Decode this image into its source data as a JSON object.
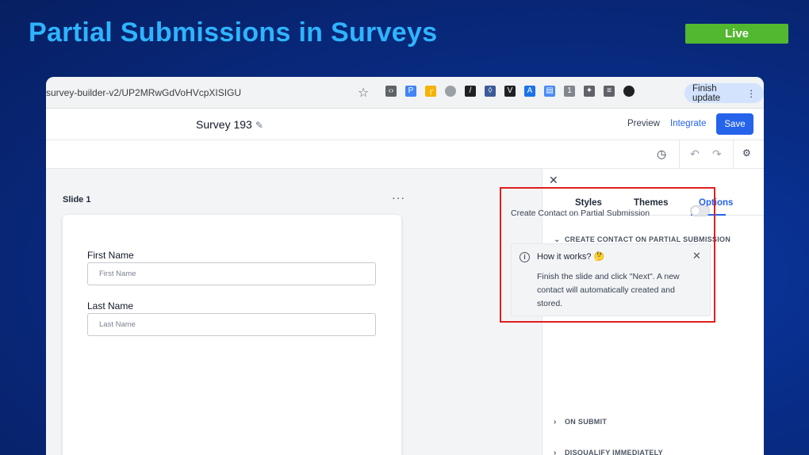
{
  "slide": {
    "title": "Partial Submissions in Surveys",
    "badge": "Live"
  },
  "browser": {
    "url": "survey-builder-v2/UP2MRwGdVoHVcpXISIGU",
    "finish_update_label": "Finish update",
    "finish_update_menu": "⋮",
    "bookmark_icon": "star-icon"
  },
  "header": {
    "survey_name": "Survey 193",
    "preview_label": "Preview",
    "integrate_label": "Integrate",
    "save_label": "Save"
  },
  "form": {
    "slide_label": "Slide 1",
    "slide_menu": "···",
    "fields": [
      {
        "label": "First Name",
        "placeholder": "First Name"
      },
      {
        "label": "Last Name",
        "placeholder": "Last Name"
      }
    ]
  },
  "panel": {
    "tabs": [
      "Styles",
      "Themes",
      "Options"
    ],
    "active_tab": "Options",
    "sections": {
      "create_contact": "CREATE CONTACT ON PARTIAL SUBMISSION",
      "on_submit": "ON SUBMIT",
      "disqualify": "DISQUALIFY IMMEDIATELY"
    },
    "toggle_label": "Create Contact on Partial Submission",
    "toggle_on": false,
    "info": {
      "title": "How it works? 🤔",
      "text": "Finish the slide and click \"Next\". A new contact will automatically created and stored."
    }
  },
  "colors": {
    "accent": "#2563eb",
    "title": "#2fb4ff",
    "live": "#52b82f",
    "highlight": "#e01e1e"
  }
}
